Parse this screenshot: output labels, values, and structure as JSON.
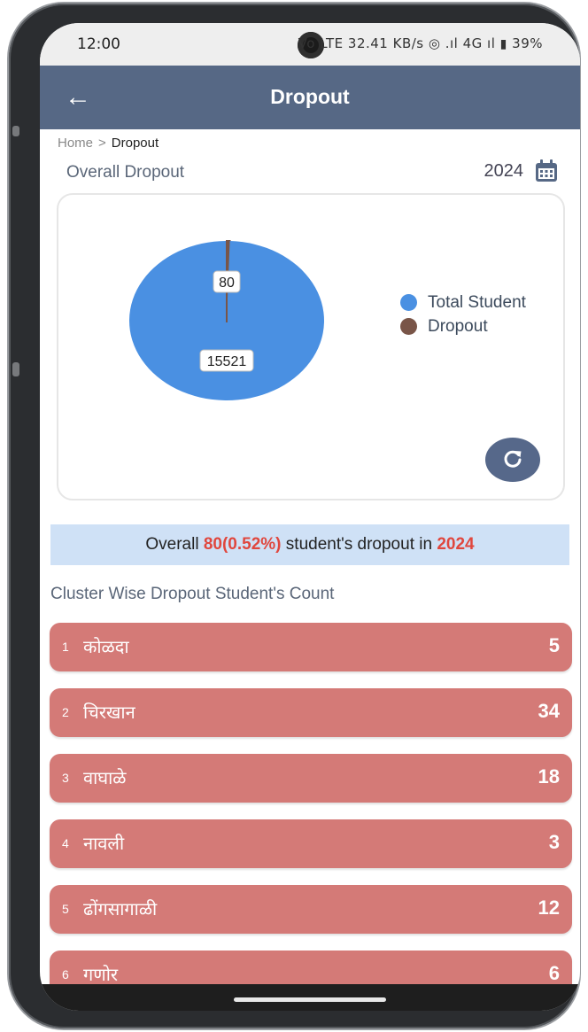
{
  "status_bar": {
    "time": "12:00",
    "indicators": "Vo LTE 32.41 KB/s ◎ .ıl 4G ıl",
    "battery": "39%"
  },
  "header": {
    "title": "Dropout",
    "back_icon": "arrow-left-icon"
  },
  "breadcrumb": {
    "home": "Home",
    "separator": ">",
    "current": "Dropout"
  },
  "overview": {
    "title": "Overall Dropout",
    "year": "2024",
    "calendar_icon": "calendar-icon"
  },
  "chart_data": {
    "type": "pie",
    "slices": [
      {
        "label": "Total Student",
        "value": 15521,
        "color": "#4a90e2"
      },
      {
        "label": "Dropout",
        "value": 80,
        "color": "#795548"
      }
    ],
    "data_labels": [
      "80",
      "15521"
    ],
    "legend_position": "right"
  },
  "refresh": {
    "icon": "refresh-icon"
  },
  "summary": {
    "prefix": "Overall",
    "value": "80(0.52%)",
    "middle": "student's dropout in",
    "year": "2024"
  },
  "clusters": {
    "title": "Cluster Wise Dropout Student's Count",
    "items": [
      {
        "index": "1",
        "name": "कोळदा",
        "count": "5"
      },
      {
        "index": "2",
        "name": "चिरखान",
        "count": "34"
      },
      {
        "index": "3",
        "name": "वाघाळे",
        "count": "18"
      },
      {
        "index": "4",
        "name": "नावली",
        "count": "3"
      },
      {
        "index": "5",
        "name": "ढोंगसागाळी",
        "count": "12"
      },
      {
        "index": "6",
        "name": "गणोर",
        "count": "6"
      }
    ]
  },
  "colors": {
    "appbar": "#566885",
    "cluster_row": "#d47a77",
    "highlight": "#e0473e",
    "summary_bg": "#cfe1f6"
  }
}
